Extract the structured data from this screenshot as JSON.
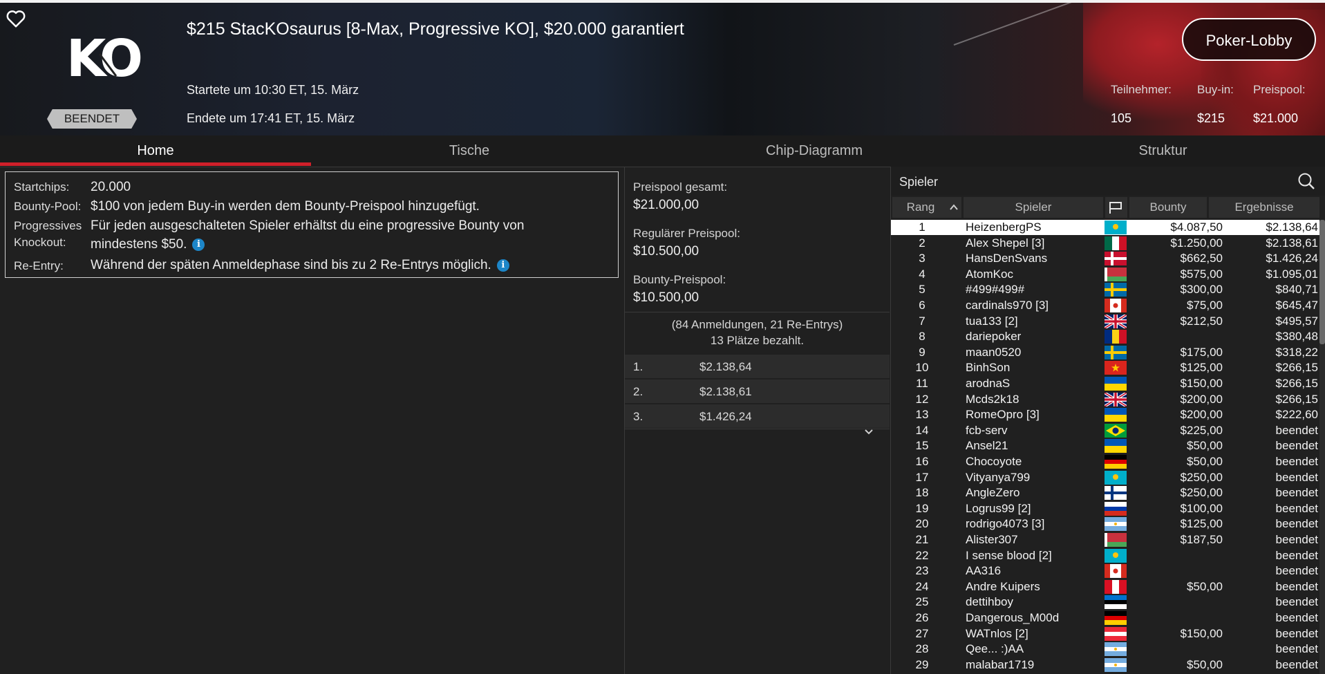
{
  "header": {
    "logo_text": "KO",
    "status": "BEENDET",
    "title": "$215 StacKOsaurus [8-Max, Progressive KO], $20.000 garantiert",
    "started": "Startete um 10:30 ET, 15. März",
    "ended": "Endete um 17:41 ET, 15. März",
    "lobby_button": "Poker-Lobby",
    "stats": [
      {
        "label": "Teilnehmer:",
        "value": "105"
      },
      {
        "label": "Buy-in:",
        "value": "$215"
      },
      {
        "label": "Preispool:",
        "value": "$21.000"
      }
    ]
  },
  "tabs": [
    "Home",
    "Tische",
    "Chip-Diagramm",
    "Struktur"
  ],
  "info": {
    "startchips_label": "Startchips:",
    "startchips_value": "20.000",
    "bountypool_label": "Bounty-Pool:",
    "bountypool_value": "$100 von jedem Buy-in werden dem Bounty-Preispool hinzugefügt.",
    "pko_label_1": "Progressives",
    "pko_label_2": "Knockout:",
    "pko_value_1": "Für jeden ausgeschalteten Spieler erhältst du eine progressive Bounty von",
    "pko_value_2": "mindestens $50.",
    "reentry_label": "Re-Entry:",
    "reentry_value": "Während der späten Anmeldephase sind bis zu 2 Re-Entrys möglich."
  },
  "prize": {
    "total_label": "Preispool gesamt:",
    "total_value": "$21.000,00",
    "regular_label": "Regulärer Preispool:",
    "regular_value": "$10.500,00",
    "bounty_label": "Bounty-Preispool:",
    "bounty_value": "$10.500,00",
    "note_1": "(84 Anmeldungen, 21 Re-Entrys)",
    "note_2": "13 Plätze bezahlt.",
    "places": [
      {
        "rank": "1.",
        "amount": "$2.138,64"
      },
      {
        "rank": "2.",
        "amount": "$2.138,61"
      },
      {
        "rank": "3.",
        "amount": "$1.426,24"
      }
    ]
  },
  "players": {
    "title": "Spieler",
    "columns": {
      "rank": "Rang",
      "player": "Spieler",
      "bounty": "Bounty",
      "result": "Ergebnisse"
    },
    "rows": [
      {
        "rank": "1",
        "name": "HeizenbergPS",
        "flag": "kz",
        "bounty": "$4.087,50",
        "result": "$2.138,64"
      },
      {
        "rank": "2",
        "name": "Alex Shepel [3]",
        "flag": "mx",
        "bounty": "$1.250,00",
        "result": "$2.138,61"
      },
      {
        "rank": "3",
        "name": "HansDenSvans",
        "flag": "dk",
        "bounty": "$662,50",
        "result": "$1.426,24"
      },
      {
        "rank": "4",
        "name": "AtomKoc",
        "flag": "by",
        "bounty": "$575,00",
        "result": "$1.095,01"
      },
      {
        "rank": "5",
        "name": "#499#499#",
        "flag": "se",
        "bounty": "$300,00",
        "result": "$840,71"
      },
      {
        "rank": "6",
        "name": "cardinals970 [3]",
        "flag": "ca",
        "bounty": "$75,00",
        "result": "$645,47"
      },
      {
        "rank": "7",
        "name": "tua133 [2]",
        "flag": "gb",
        "bounty": "$212,50",
        "result": "$495,57"
      },
      {
        "rank": "8",
        "name": "dariepoker",
        "flag": "ro",
        "bounty": "",
        "result": "$380,48"
      },
      {
        "rank": "9",
        "name": "maan0520",
        "flag": "se",
        "bounty": "$175,00",
        "result": "$318,22"
      },
      {
        "rank": "10",
        "name": "BinhSon",
        "flag": "vn",
        "bounty": "$125,00",
        "result": "$266,15"
      },
      {
        "rank": "11",
        "name": "arodnaS",
        "flag": "ua",
        "bounty": "$150,00",
        "result": "$266,15"
      },
      {
        "rank": "12",
        "name": "Mcds2k18",
        "flag": "gb",
        "bounty": "$200,00",
        "result": "$266,15"
      },
      {
        "rank": "13",
        "name": "RomeOpro [3]",
        "flag": "ua",
        "bounty": "$200,00",
        "result": "$222,60"
      },
      {
        "rank": "14",
        "name": "fcb-serv",
        "flag": "br",
        "bounty": "$225,00",
        "result": "beendet"
      },
      {
        "rank": "15",
        "name": "Ansel21",
        "flag": "ua",
        "bounty": "$50,00",
        "result": "beendet"
      },
      {
        "rank": "16",
        "name": "Chocoyote",
        "flag": "de",
        "bounty": "$50,00",
        "result": "beendet"
      },
      {
        "rank": "17",
        "name": "Vityanya799",
        "flag": "kz",
        "bounty": "$250,00",
        "result": "beendet"
      },
      {
        "rank": "18",
        "name": "AngleZero",
        "flag": "fi",
        "bounty": "$250,00",
        "result": "beendet"
      },
      {
        "rank": "19",
        "name": "Logrus99 [2]",
        "flag": "ru",
        "bounty": "$100,00",
        "result": "beendet"
      },
      {
        "rank": "20",
        "name": "rodrigo4073 [3]",
        "flag": "ar",
        "bounty": "$125,00",
        "result": "beendet"
      },
      {
        "rank": "21",
        "name": "Alister307",
        "flag": "by",
        "bounty": "$187,50",
        "result": "beendet"
      },
      {
        "rank": "22",
        "name": "I sense blood [2]",
        "flag": "kz",
        "bounty": "",
        "result": "beendet"
      },
      {
        "rank": "23",
        "name": "AA316",
        "flag": "ca",
        "bounty": "",
        "result": "beendet"
      },
      {
        "rank": "24",
        "name": "Andre Kuipers",
        "flag": "pe",
        "bounty": "$50,00",
        "result": "beendet"
      },
      {
        "rank": "25",
        "name": "dettihboy",
        "flag": "ee",
        "bounty": "",
        "result": "beendet"
      },
      {
        "rank": "26",
        "name": "Dangerous_M00d",
        "flag": "de",
        "bounty": "",
        "result": "beendet"
      },
      {
        "rank": "27",
        "name": "WATnlos [2]",
        "flag": "at",
        "bounty": "$150,00",
        "result": "beendet"
      },
      {
        "rank": "28",
        "name": "Qee... :)AA",
        "flag": "ar",
        "bounty": "",
        "result": "beendet"
      },
      {
        "rank": "29",
        "name": "malabar1719",
        "flag": "ar",
        "bounty": "$50,00",
        "result": "beendet"
      }
    ]
  },
  "colors": {
    "accent_tab": "#d0202a",
    "info_icon": "#1d86c8",
    "background": "#202020"
  }
}
